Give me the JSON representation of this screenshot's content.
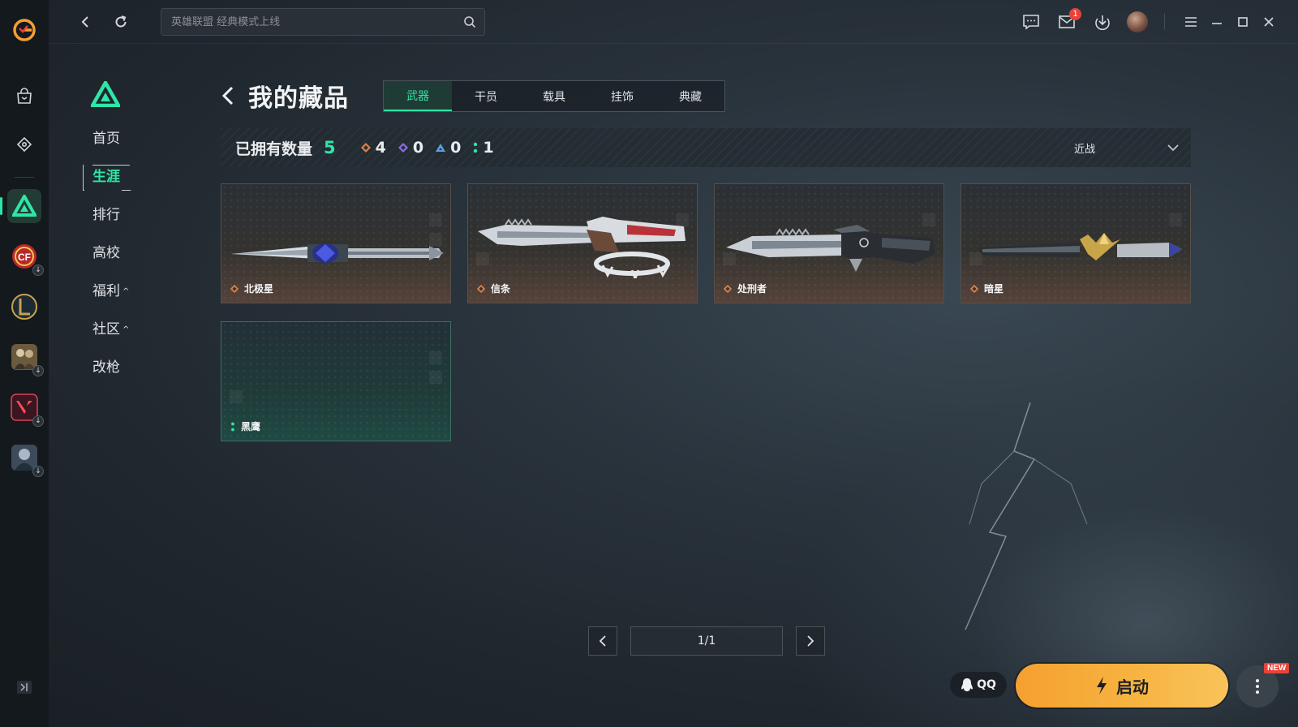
{
  "window": {
    "title": "WeGame",
    "controls": {
      "menu": "menu-icon",
      "minimize": "minimize-icon",
      "maximize": "maximize-icon",
      "close": "close-icon"
    }
  },
  "search": {
    "placeholder": "英雄联盟 经典模式上线"
  },
  "topbar": {
    "mail_badge": "1"
  },
  "rail": {
    "items": [
      "store-icon",
      "gift-icon"
    ],
    "games": [
      "valorant",
      "crossfire",
      "league-of-legends",
      "pubg",
      "valorant-alt",
      "naraka"
    ]
  },
  "subnav": {
    "items": [
      {
        "label": "首页"
      },
      {
        "label": "生涯"
      },
      {
        "label": "排行"
      },
      {
        "label": "高校"
      },
      {
        "label": "福利"
      },
      {
        "label": "社区"
      },
      {
        "label": "改枪"
      }
    ]
  },
  "page": {
    "title": "我的藏品",
    "tabs": [
      "武器",
      "干员",
      "载具",
      "挂饰",
      "典藏"
    ]
  },
  "stats": {
    "label": "已拥有数量",
    "total": "5",
    "rarities": [
      {
        "count": "4",
        "color": "#d9824a"
      },
      {
        "count": "0",
        "color": "#8c6fe0"
      },
      {
        "count": "0",
        "color": "#5aa0e6"
      },
      {
        "count": "1",
        "color": "#2ee6a6"
      }
    ],
    "filter": "近战"
  },
  "items": [
    {
      "name": "北极星",
      "rarity_color": "#d9824a"
    },
    {
      "name": "信条",
      "rarity_color": "#d9824a"
    },
    {
      "name": "处刑者",
      "rarity_color": "#d9824a"
    },
    {
      "name": "暗星",
      "rarity_color": "#d9824a"
    },
    {
      "name": "黑鹰",
      "rarity_color": "#2ee6a6"
    }
  ],
  "pager": {
    "text": "1/1"
  },
  "bottom": {
    "qq_label": "QQ",
    "launch_label": "启动",
    "new_badge": "NEW"
  },
  "colors": {
    "accent": "#2ee6a6",
    "launch": "#f7b340",
    "badge": "#e8433a"
  }
}
